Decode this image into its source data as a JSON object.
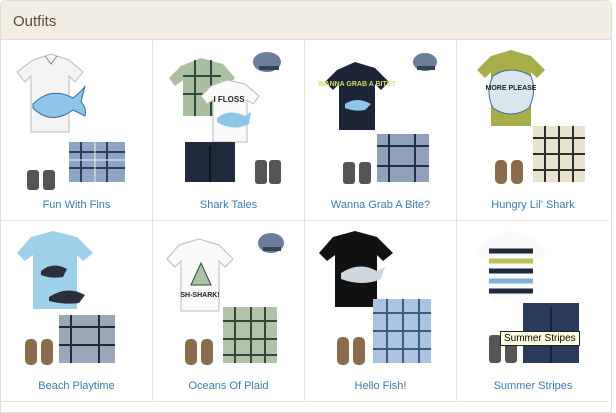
{
  "section": {
    "title": "Outfits"
  },
  "outfits": [
    {
      "name": "Fun With Fins"
    },
    {
      "name": "Shark Tales"
    },
    {
      "name": "Wanna Grab A Bite?"
    },
    {
      "name": "Hungry Lil' Shark"
    },
    {
      "name": "Beach Playtime"
    },
    {
      "name": "Oceans Of Plaid"
    },
    {
      "name": "Hello Fish!"
    },
    {
      "name": "Summer Stripes"
    }
  ],
  "shirt_text": {
    "shark_tales": "I FLOSS",
    "wanna_grab": "WANNA GRAB A BITE?",
    "hungry": "MORE PLEASE",
    "oceans": "SH-SHARK!"
  },
  "tooltip": {
    "text": "Summer Stripes"
  },
  "colors": {
    "link": "#3f79ae",
    "header_bg": "#f3eee3",
    "border": "#e2ddd2"
  }
}
